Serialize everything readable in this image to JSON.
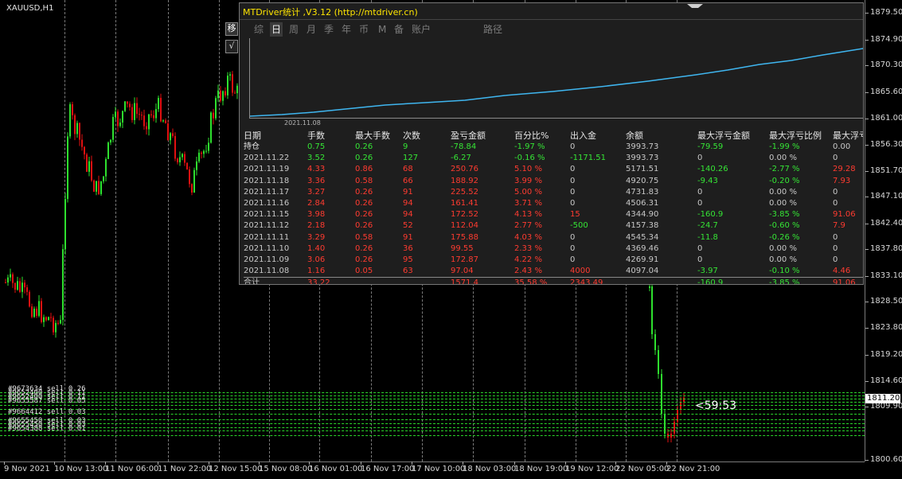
{
  "symbol": "XAUUSD,H1",
  "price_axis": {
    "ticks": [
      "1879.50",
      "1874.90",
      "1870.30",
      "1865.60",
      "1861.00",
      "1856.30",
      "1851.70",
      "1847.10",
      "1842.40",
      "1837.80",
      "1833.10",
      "1828.50",
      "1823.80",
      "1819.20",
      "1814.60",
      "1809.90",
      "1800.60"
    ],
    "current_price": "1811.20"
  },
  "time_axis": {
    "ticks": [
      "9 Nov 2021",
      "10 Nov 13:00",
      "11 Nov 06:00",
      "11 Nov 22:00",
      "12 Nov 15:00",
      "15 Nov 08:00",
      "16 Nov 01:00",
      "16 Nov 17:00",
      "17 Nov 10:00",
      "18 Nov 03:00",
      "18 Nov 19:00",
      "19 Nov 12:00",
      "22 Nov 05:00",
      "22 Nov 21:00"
    ]
  },
  "orders": [
    "#9673634 sell 0.26",
    "#9652400 sell 0.11",
    "#9655587 sell 0.05",
    "#9664412 sell 0.03",
    "#9655450 sell 0.03",
    "#9654388 sell 0.01"
  ],
  "countdown": "<59:53",
  "side_buttons": [
    "移",
    "√"
  ],
  "panel": {
    "title": "MTDriver统计 ,V3.12 (http://mtdriver.cn)",
    "tabs": [
      "综",
      "日",
      "周",
      "月",
      "季",
      "年",
      "币",
      "M",
      "备",
      "账户",
      "路径"
    ],
    "active_tab": "日",
    "curve_start_date": "2021.11.08",
    "curve_color": "#3fb6f0",
    "columns": [
      "日期",
      "手数",
      "最大手数",
      "次数",
      "盈亏金额",
      "百分比%",
      "出入金",
      "余额",
      "最大浮亏金额",
      "最大浮亏比例",
      "最大浮亏"
    ],
    "rows": [
      {
        "c": [
          "持仓",
          "0.75",
          "0.26",
          "9",
          "-78.84",
          "-1.97 %",
          "0",
          "3993.73",
          "-79.59",
          "-1.99 %",
          "0.00"
        ],
        "t": "open"
      },
      {
        "c": [
          "2021.11.22",
          "3.52",
          "0.26",
          "127",
          "-6.27",
          "-0.16 %",
          "-1171.51",
          "3993.73",
          "0",
          "0.00 %",
          "0"
        ],
        "t": "loss"
      },
      {
        "c": [
          "2021.11.19",
          "4.33",
          "0.86",
          "68",
          "250.76",
          "5.10 %",
          "0",
          "5171.51",
          "-140.26",
          "-2.77 %",
          "29.28"
        ],
        "t": "win"
      },
      {
        "c": [
          "2021.11.18",
          "3.36",
          "0.58",
          "66",
          "188.92",
          "3.99 %",
          "0",
          "4920.75",
          "-9.43",
          "-0.20 %",
          "7.93"
        ],
        "t": "win"
      },
      {
        "c": [
          "2021.11.17",
          "3.27",
          "0.26",
          "91",
          "225.52",
          "5.00 %",
          "0",
          "4731.83",
          "0",
          "0.00 %",
          "0"
        ],
        "t": "win"
      },
      {
        "c": [
          "2021.11.16",
          "2.84",
          "0.26",
          "94",
          "161.41",
          "3.71 %",
          "0",
          "4506.31",
          "0",
          "0.00 %",
          "0"
        ],
        "t": "win"
      },
      {
        "c": [
          "2021.11.15",
          "3.98",
          "0.26",
          "94",
          "172.52",
          "4.13 %",
          "15",
          "4344.90",
          "-160.9",
          "-3.85 %",
          "91.06"
        ],
        "t": "win"
      },
      {
        "c": [
          "2021.11.12",
          "2.18",
          "0.26",
          "52",
          "112.04",
          "2.77 %",
          "-500",
          "4157.38",
          "-24.7",
          "-0.60 %",
          "7.9"
        ],
        "t": "win"
      },
      {
        "c": [
          "2021.11.11",
          "3.29",
          "0.58",
          "91",
          "175.88",
          "4.03 %",
          "0",
          "4545.34",
          "-11.8",
          "-0.26 %",
          "0"
        ],
        "t": "win"
      },
      {
        "c": [
          "2021.11.10",
          "1.40",
          "0.26",
          "36",
          "99.55",
          "2.33 %",
          "0",
          "4369.46",
          "0",
          "0.00 %",
          "0"
        ],
        "t": "win"
      },
      {
        "c": [
          "2021.11.09",
          "3.06",
          "0.26",
          "95",
          "172.87",
          "4.22 %",
          "0",
          "4269.91",
          "0",
          "0.00 %",
          "0"
        ],
        "t": "win"
      },
      {
        "c": [
          "2021.11.08",
          "1.16",
          "0.05",
          "63",
          "97.04",
          "2.43 %",
          "4000",
          "4097.04",
          "-3.97",
          "-0.10 %",
          "4.46"
        ],
        "t": "win"
      }
    ],
    "total": {
      "c": [
        "合计",
        "33.22",
        "",
        "",
        "1571.4",
        "35.58 %",
        "2343.49",
        "",
        "-160.9",
        "-3.85 %",
        "91.06"
      ]
    }
  },
  "colors": {
    "up": "#2ee02e",
    "down": "#e01010",
    "grid": "#7a7a7a",
    "neutral": "#c8c8c8",
    "red_text": "#ff3b30",
    "green_text": "#35e535"
  }
}
